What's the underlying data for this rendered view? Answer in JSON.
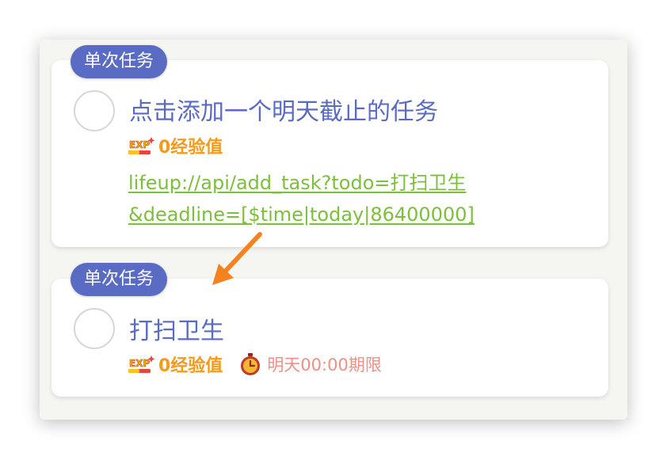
{
  "task1": {
    "badge": "单次任务",
    "title": "点击添加一个明天截止的任务",
    "exp": "0经验值",
    "link_line1": "lifeup://api/add_task?todo=打扫卫生",
    "link_line2": "&deadline=[$time|today|86400000]"
  },
  "task2": {
    "badge": "单次任务",
    "title": "打扫卫生",
    "exp": "0经验值",
    "deadline": "明天00:00期限"
  },
  "icons": {
    "exp": "exp-icon",
    "deadline": "alarm-clock-icon",
    "checkbox": "circle-checkbox",
    "annotation": "arrow-icon"
  },
  "colors": {
    "badge": "#5a6bc4",
    "title": "#5a6bc4",
    "exp": "#f59a1b",
    "link": "#7cbf3d",
    "deadline": "#ef8f86",
    "arrow": "#f5821f"
  }
}
